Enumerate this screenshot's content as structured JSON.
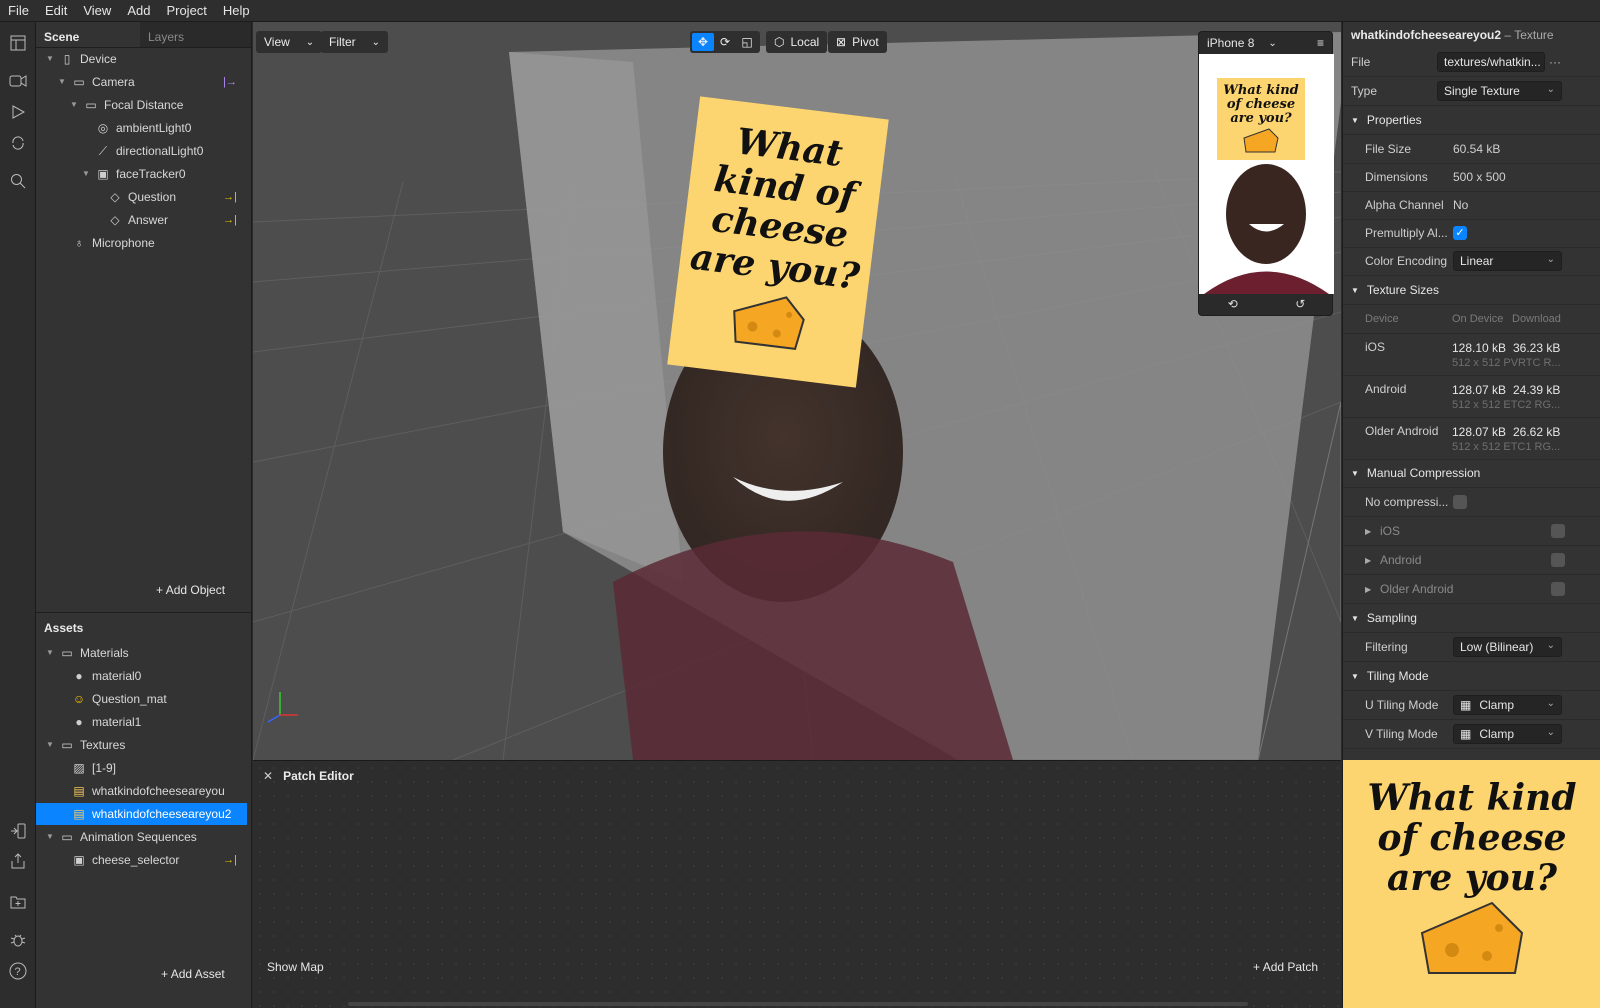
{
  "menu": [
    "File",
    "Edit",
    "View",
    "Add",
    "Project",
    "Help"
  ],
  "scene": {
    "tabs": [
      "Scene",
      "Layers"
    ],
    "items": [
      {
        "label": "Device",
        "icon": "phone-icon",
        "depth": 0,
        "expanded": true
      },
      {
        "label": "Camera",
        "icon": "camera-icon",
        "depth": 1,
        "expanded": true,
        "badge": "|→"
      },
      {
        "label": "Focal Distance",
        "icon": "focal-icon",
        "depth": 2,
        "expanded": true
      },
      {
        "label": "ambientLight0",
        "icon": "globe-light-icon",
        "depth": 3
      },
      {
        "label": "directionalLight0",
        "icon": "directional-light-icon",
        "depth": 3
      },
      {
        "label": "faceTracker0",
        "icon": "face-tracker-icon",
        "depth": 3,
        "expanded": true
      },
      {
        "label": "Question",
        "icon": "plane-icon",
        "depth": 4,
        "badge": "→|"
      },
      {
        "label": "Answer",
        "icon": "plane-icon",
        "depth": 4,
        "badge": "→|"
      },
      {
        "label": "Microphone",
        "icon": "microphone-icon",
        "depth": 1
      }
    ],
    "add_object": "Add Object"
  },
  "assets": {
    "title": "Assets",
    "items": [
      {
        "label": "Materials",
        "icon": "folder-icon",
        "depth": 0,
        "expanded": true
      },
      {
        "label": "material0",
        "icon": "sphere-icon",
        "depth": 1
      },
      {
        "label": "Question_mat",
        "icon": "emoji-material-icon",
        "depth": 1
      },
      {
        "label": "material1",
        "icon": "sphere-icon",
        "depth": 1
      },
      {
        "label": "Textures",
        "icon": "folder-icon",
        "depth": 0,
        "expanded": true
      },
      {
        "label": "[1-9]",
        "icon": "image-icon",
        "depth": 1
      },
      {
        "label": "whatkindofcheeseareyou",
        "icon": "texture-thumb-icon",
        "depth": 1
      },
      {
        "label": "whatkindofcheeseareyou2",
        "icon": "texture-thumb-icon",
        "depth": 1,
        "selected": true
      },
      {
        "label": "Animation Sequences",
        "icon": "folder-icon",
        "depth": 0,
        "expanded": true
      },
      {
        "label": "cheese_selector",
        "icon": "sequence-icon",
        "depth": 1,
        "badge": "→|"
      }
    ],
    "add_asset": "Add Asset"
  },
  "viewport": {
    "view_btn": "View",
    "filter_btn": "Filter",
    "local_btn": "Local",
    "pivot_btn": "Pivot",
    "device_select": "iPhone 8",
    "poster_text": "What kind of cheese are you?"
  },
  "patch_editor": {
    "title": "Patch Editor",
    "show_map": "Show Map",
    "add_patch": "Add Patch"
  },
  "inspector": {
    "title": "whatkindofcheeseareyou2",
    "type_suffix": "– Texture",
    "file_label": "File",
    "file_value": "textures/whatkin...",
    "type_label": "Type",
    "type_value": "Single Texture",
    "properties_header": "Properties",
    "file_size_label": "File Size",
    "file_size": "60.54 kB",
    "dimensions_label": "Dimensions",
    "dimensions": "500 x 500",
    "alpha_label": "Alpha Channel",
    "alpha": "No",
    "premultiply_label": "Premultiply Al...",
    "premultiply": true,
    "color_encoding_label": "Color Encoding",
    "color_encoding": "Linear",
    "texture_sizes_header": "Texture Sizes",
    "col_device": "Device",
    "col_on_device": "On Device",
    "col_download": "Download",
    "sizes": [
      {
        "device": "iOS",
        "on_device": "128.10 kB",
        "download": "36.23 kB",
        "detail": "512 x 512 PVRTC R..."
      },
      {
        "device": "Android",
        "on_device": "128.07 kB",
        "download": "24.39 kB",
        "detail": "512 x 512 ETC2 RG..."
      },
      {
        "device": "Older Android",
        "on_device": "128.07 kB",
        "download": "26.62 kB",
        "detail": "512 x 512 ETC1 RG..."
      }
    ],
    "manual_header": "Manual Compression",
    "no_compression": "No compressi...",
    "manual_platforms": [
      "iOS",
      "Android",
      "Older Android"
    ],
    "sampling_header": "Sampling",
    "filtering_label": "Filtering",
    "filtering": "Low (Bilinear)",
    "tiling_header": "Tiling Mode",
    "u_tiling_label": "U Tiling Mode",
    "u_tiling": "Clamp",
    "v_tiling_label": "V Tiling Mode",
    "v_tiling": "Clamp",
    "preview_text": "What kind of cheese are you?"
  },
  "colors": {
    "accent": "#0a84ff",
    "poster": "#fdd570",
    "badge": "#e6c700"
  }
}
